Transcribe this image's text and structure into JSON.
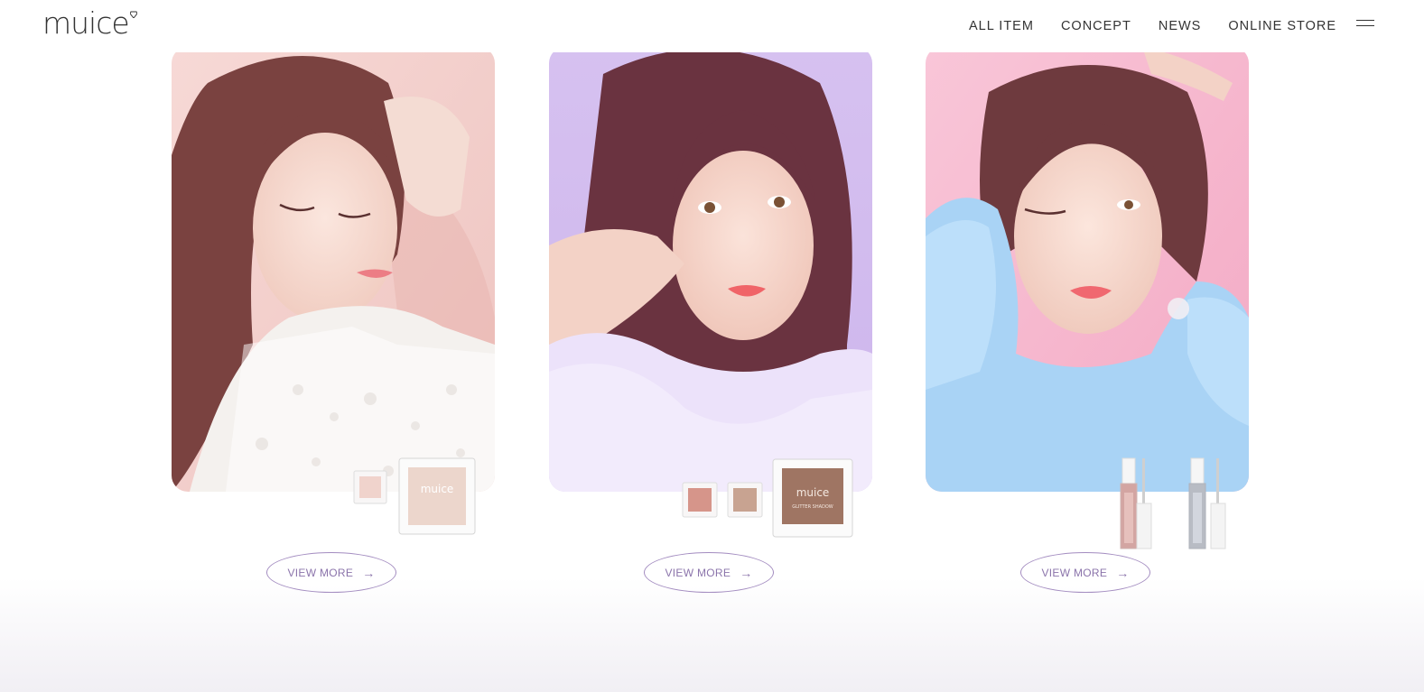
{
  "brand": {
    "name": "muice",
    "accent": "#a38cc0"
  },
  "nav": {
    "items": [
      "ALL ITEM",
      "CONCEPT",
      "NEWS",
      "ONLINE STORE"
    ],
    "menu_icon": "hamburger-icon"
  },
  "cards": [
    {
      "background": "#f5cdcd",
      "button_label": "VIEW MORE",
      "product_label": "muice",
      "button_icon": "arrow-right-icon"
    },
    {
      "background": "#d3bff0",
      "button_label": "VIEW MORE",
      "product_label": "muice",
      "product_sublabel": "GLITTER SHADOW",
      "button_icon": "arrow-right-icon"
    },
    {
      "background": "#f5b9cf",
      "button_label": "VIEW MORE",
      "button_icon": "arrow-right-icon"
    }
  ]
}
